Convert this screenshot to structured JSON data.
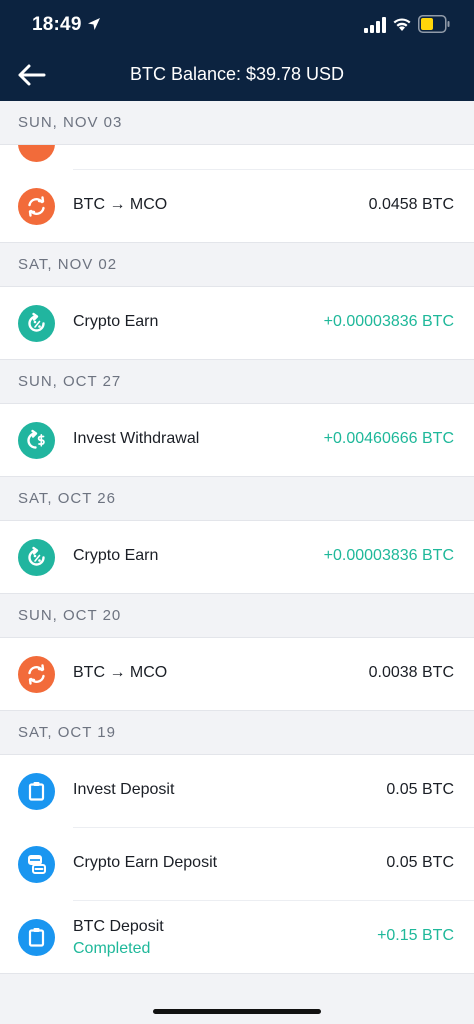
{
  "status_bar": {
    "time": "18:49"
  },
  "nav": {
    "title": "BTC Balance: $39.78 USD"
  },
  "colors": {
    "header_bg": "#0c2340",
    "orange": "#f26b3a",
    "teal": "#21b59f",
    "blue": "#1a96f0",
    "positive_text": "#1fb89a"
  },
  "groups": [
    {
      "date": "SUN, NOV 03",
      "transactions": [
        {
          "icon": "exchange-icon",
          "label": "BTC → MCO",
          "amount": "0.0458 BTC"
        }
      ]
    },
    {
      "date": "SAT, NOV 02",
      "transactions": [
        {
          "icon": "earn-icon",
          "label": "Crypto Earn",
          "amount": "+0.00003836 BTC"
        }
      ]
    },
    {
      "date": "SUN, OCT 27",
      "transactions": [
        {
          "icon": "withdrawal-icon",
          "label": "Invest Withdrawal",
          "amount": "+0.00460666 BTC"
        }
      ]
    },
    {
      "date": "SAT, OCT 26",
      "transactions": [
        {
          "icon": "earn-icon",
          "label": "Crypto Earn",
          "amount": "+0.00003836 BTC"
        }
      ]
    },
    {
      "date": "SUN, OCT 20",
      "transactions": [
        {
          "icon": "exchange-icon",
          "label": "BTC → MCO",
          "amount": "0.0038 BTC"
        }
      ]
    },
    {
      "date": "SAT, OCT 19",
      "transactions": [
        {
          "icon": "clipboard-icon",
          "label": "Invest Deposit",
          "amount": "0.05 BTC"
        },
        {
          "icon": "coins-icon",
          "label": "Crypto Earn Deposit",
          "amount": "0.05 BTC"
        },
        {
          "icon": "clipboard-icon",
          "label": "BTC Deposit",
          "status": "Completed",
          "amount": "+0.15 BTC"
        }
      ]
    }
  ]
}
